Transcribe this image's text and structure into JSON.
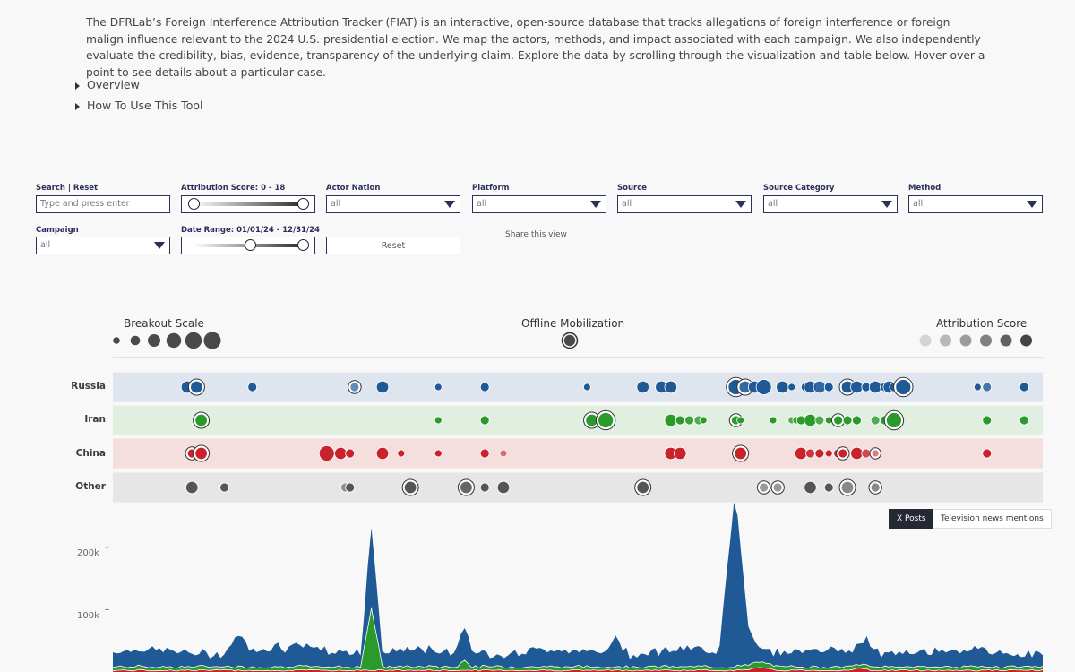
{
  "intro": {
    "text": "The DFRLab’s Foreign Interference Attribution Tracker (FIAT) is an interactive, open-source database that tracks allegations of foreign interference or foreign malign influence relevant to the 2024 U.S. presidential election. We map the actors, methods, and impact associated with each campaign. We also independently evaluate the credibility, bias, evidence, transparency of the underlying claim. Explore the data by scrolling through the visualization and table below. Hover over a point to see details about a particular case."
  },
  "details": {
    "overview": "Overview",
    "how_to": "How To Use This Tool"
  },
  "filters": {
    "search": {
      "label": "Search | Reset",
      "placeholder": "Type and press enter"
    },
    "attribution": {
      "label": "Attribution Score: 0 - 18",
      "min": 0,
      "max": 18
    },
    "actor_nation": {
      "label": "Actor Nation",
      "value": "all"
    },
    "platform": {
      "label": "Platform",
      "value": "all"
    },
    "source": {
      "label": "Source",
      "value": "all"
    },
    "source_category": {
      "label": "Source Category",
      "value": "all"
    },
    "method": {
      "label": "Method",
      "value": "all"
    },
    "campaign": {
      "label": "Campaign",
      "value": "all"
    },
    "date_range": {
      "label": "Date Range: 01/01/24 - 12/31/24",
      "handle_fraction": 0.55
    },
    "reset": "Reset",
    "share": "Share this view"
  },
  "legend": {
    "breakout": "Breakout Scale",
    "offline": "Offline Mobilization",
    "attribution": "Attribution Score"
  },
  "colors": {
    "russia": "#1f5a96",
    "iran": "#2a9a2a",
    "china": "#c8232b",
    "other": "#555555",
    "russia_bg": "#dfe5ee",
    "iran_bg": "#e0efdf",
    "china_bg": "#f5dede",
    "other_bg": "#e6e6e6"
  },
  "lanes": [
    {
      "label": "Russia",
      "color": "#1f5a96",
      "bg": "#dfe5ee"
    },
    {
      "label": "Iran",
      "color": "#2a9a2a",
      "bg": "#e0efdf"
    },
    {
      "label": "China",
      "color": "#c8232b",
      "bg": "#f5dede"
    },
    {
      "label": "Other",
      "color": "#555555",
      "bg": "#e6e6e6"
    }
  ],
  "cases": {
    "Russia": [
      [
        0.08,
        3,
        1
      ],
      [
        0.09,
        3,
        1,
        1
      ],
      [
        0.15,
        2,
        1
      ],
      [
        0.26,
        2,
        0.7,
        1
      ],
      [
        0.29,
        3,
        1
      ],
      [
        0.35,
        1,
        1
      ],
      [
        0.4,
        2,
        1
      ],
      [
        0.51,
        1,
        1
      ],
      [
        0.57,
        3,
        1
      ],
      [
        0.59,
        3,
        1
      ],
      [
        0.6,
        3,
        1
      ],
      [
        0.67,
        4,
        1,
        1
      ],
      [
        0.68,
        3,
        0.9,
        1
      ],
      [
        0.69,
        3,
        1
      ],
      [
        0.7,
        4,
        1
      ],
      [
        0.72,
        3,
        1
      ],
      [
        0.73,
        1,
        1
      ],
      [
        0.745,
        2,
        1
      ],
      [
        0.75,
        3,
        1
      ],
      [
        0.76,
        3,
        0.9
      ],
      [
        0.77,
        2,
        1
      ],
      [
        0.79,
        3,
        1,
        1
      ],
      [
        0.8,
        3,
        1
      ],
      [
        0.81,
        2,
        1
      ],
      [
        0.82,
        3,
        1
      ],
      [
        0.83,
        2,
        1
      ],
      [
        0.835,
        3,
        1
      ],
      [
        0.84,
        2,
        1
      ],
      [
        0.85,
        4,
        1,
        1
      ],
      [
        0.93,
        1,
        1
      ],
      [
        0.94,
        2,
        0.8
      ],
      [
        0.98,
        2,
        1
      ]
    ],
    "Iran": [
      [
        0.095,
        3,
        1,
        1
      ],
      [
        0.35,
        1,
        1
      ],
      [
        0.4,
        2,
        1
      ],
      [
        0.515,
        3,
        1,
        1
      ],
      [
        0.53,
        4,
        1,
        1
      ],
      [
        0.6,
        3,
        1
      ],
      [
        0.61,
        2,
        1
      ],
      [
        0.62,
        2,
        0.9
      ],
      [
        0.63,
        2,
        0.8
      ],
      [
        0.635,
        1,
        1
      ],
      [
        0.67,
        2,
        1,
        1
      ],
      [
        0.675,
        1,
        1
      ],
      [
        0.71,
        1,
        1
      ],
      [
        0.73,
        1,
        0.8
      ],
      [
        0.735,
        1,
        1
      ],
      [
        0.74,
        2,
        1
      ],
      [
        0.75,
        3,
        1
      ],
      [
        0.76,
        2,
        0.8
      ],
      [
        0.77,
        1,
        1
      ],
      [
        0.78,
        2,
        1,
        1
      ],
      [
        0.79,
        2,
        1
      ],
      [
        0.8,
        2,
        1
      ],
      [
        0.82,
        2,
        0.8
      ],
      [
        0.83,
        2,
        1
      ],
      [
        0.835,
        2,
        0.8
      ],
      [
        0.84,
        4,
        1,
        1
      ],
      [
        0.94,
        2,
        1
      ],
      [
        0.98,
        2,
        1
      ]
    ],
    "China": [
      [
        0.085,
        2,
        1,
        1
      ],
      [
        0.095,
        3,
        1,
        1
      ],
      [
        0.23,
        4,
        1
      ],
      [
        0.245,
        3,
        1
      ],
      [
        0.255,
        2,
        1
      ],
      [
        0.29,
        3,
        1
      ],
      [
        0.31,
        1,
        1
      ],
      [
        0.35,
        1,
        1
      ],
      [
        0.4,
        2,
        1
      ],
      [
        0.42,
        1,
        0.6
      ],
      [
        0.6,
        3,
        1
      ],
      [
        0.61,
        3,
        1
      ],
      [
        0.67,
        2,
        1
      ],
      [
        0.675,
        3,
        1,
        1
      ],
      [
        0.74,
        3,
        1
      ],
      [
        0.75,
        2,
        0.9
      ],
      [
        0.76,
        2,
        1
      ],
      [
        0.77,
        1,
        1
      ],
      [
        0.78,
        2,
        1
      ],
      [
        0.785,
        2,
        1,
        1
      ],
      [
        0.8,
        3,
        1
      ],
      [
        0.81,
        2,
        0.8
      ],
      [
        0.82,
        1,
        0.6,
        1
      ],
      [
        0.94,
        2,
        1
      ]
    ],
    "Other": [
      [
        0.085,
        3,
        1
      ],
      [
        0.12,
        2,
        1
      ],
      [
        0.25,
        2,
        0.6
      ],
      [
        0.255,
        2,
        1
      ],
      [
        0.32,
        3,
        1,
        1
      ],
      [
        0.38,
        3,
        0.9,
        1
      ],
      [
        0.4,
        2,
        1
      ],
      [
        0.42,
        3,
        1
      ],
      [
        0.57,
        3,
        1,
        1
      ],
      [
        0.7,
        2,
        0.6,
        1
      ],
      [
        0.715,
        2,
        0.6,
        1
      ],
      [
        0.75,
        3,
        1
      ],
      [
        0.77,
        2,
        1
      ],
      [
        0.79,
        3,
        0.7,
        1
      ],
      [
        0.82,
        2,
        0.7,
        1
      ]
    ]
  },
  "chart_toggle": {
    "active": "X Posts",
    "inactive": "Television news mentions"
  },
  "chart_data": {
    "type": "area",
    "yticks": [
      "200k",
      "100k"
    ],
    "ylim": [
      0,
      230000
    ],
    "series": [
      {
        "name": "Russia",
        "color": "#1f5a96"
      },
      {
        "name": "Iran",
        "color": "#2a9a2a"
      },
      {
        "name": "China",
        "color": "#c8232b"
      }
    ]
  }
}
